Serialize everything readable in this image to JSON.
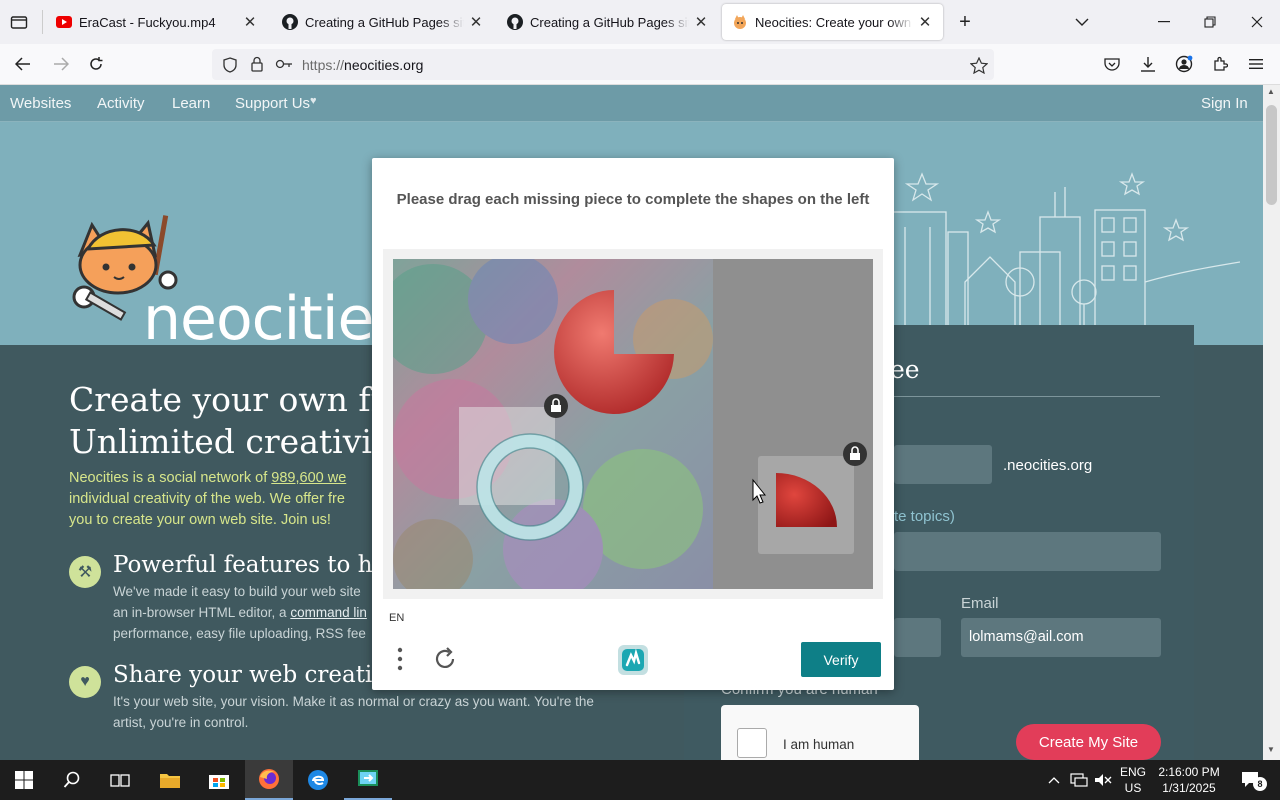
{
  "browser": {
    "tabs": [
      {
        "title": "EraCast - Fuckyou.mp4",
        "icon": "youtube-icon"
      },
      {
        "title": "Creating a GitHub Pages site - GitHub Docs",
        "icon": "github-icon"
      },
      {
        "title": "Creating a GitHub Pages site - GitHub Docs",
        "icon": "github-icon"
      },
      {
        "title": "Neocities: Create your own free website!",
        "icon": "neocities-icon"
      }
    ],
    "url_prefix": "https://",
    "url_domain": "neocities.org"
  },
  "site": {
    "nav": [
      "Websites",
      "Activity",
      "Learn",
      "Support Us",
      "Sign In"
    ],
    "support_heart": "♥",
    "logo_text": "neocities",
    "headline_1": "Create your own fre",
    "headline_2": "Unlimited creativity",
    "intro_1a": "Neocities is a social network of ",
    "intro_1b": "989,600 we",
    "intro_2": "individual creativity of the web. We offer fre",
    "intro_3": "you to create your own web site. Join us!",
    "feature1_title": "Powerful features to hel",
    "feature1_line1": "We've made it easy to build your web site",
    "feature1_line2a": "an in-browser HTML editor, a ",
    "feature1_line2b": "command lin",
    "feature1_line3": "performance, easy file uploading, RSS fee",
    "feature2_title": "Share your web creation",
    "feature2_line1": "It's your web site, your vision. Make it as normal or crazy as you want. You're the",
    "feature2_line2": "artist, you're in control.",
    "signup_heading": "ee",
    "domain_suffix": ".neocities.org",
    "topics_link": "te topics)",
    "email_label": "Email",
    "email_value": "lolmams@ail.com",
    "confirm_label": "Confirm you are human",
    "human_label": "I am human",
    "create_button": "Create My Site"
  },
  "captcha": {
    "prompt": "Please drag each missing piece to complete the shapes on the left",
    "language": "EN",
    "verify_label": "Verify"
  },
  "taskbar": {
    "lang_1": "ENG",
    "lang_2": "US",
    "time": "2:16:00 PM",
    "date": "1/31/2025",
    "notification_count": "8"
  },
  "colors": {
    "site_nav": "#6d9ba7",
    "hero": "#7fb0bc",
    "main": "#40595f",
    "accent_green": "#d7e68b",
    "create_button": "#e23d59",
    "verify_button": "#0e7f87"
  }
}
